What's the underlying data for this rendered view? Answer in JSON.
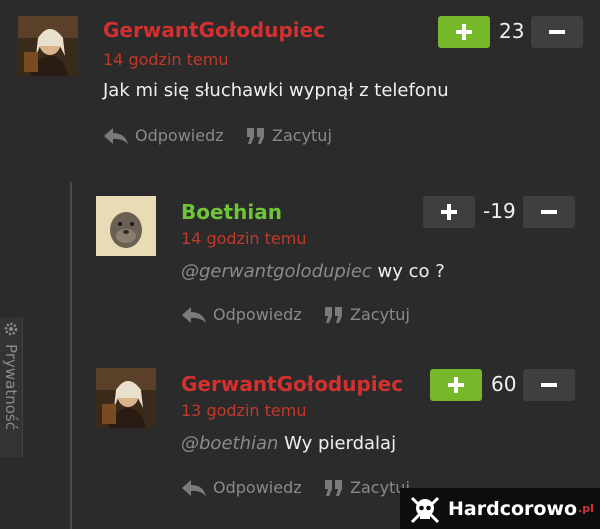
{
  "colors": {
    "background": "#2b2b2b",
    "username_red": "#d4302f",
    "username_green": "#6fc437",
    "timestamp_red": "#c0392b",
    "upvote_green": "#76b82a",
    "button_gray": "#3f3f3f",
    "muted": "#8a8a8a"
  },
  "comments": [
    {
      "username": "GerwantGołodupiec",
      "timestamp": "14 godzin temu",
      "text": "Jak mi się słuchawki wypnął z telefonu",
      "mention": "",
      "score": "23",
      "reply_label": "Odpowiedz",
      "quote_label": "Zacytuj",
      "upvote_icon": "plus-icon",
      "downvote_icon": "minus-icon"
    },
    {
      "username": "Boethian",
      "timestamp": "14 godzin temu",
      "text": "wy co ?",
      "mention": "@gerwantgolodupiec",
      "score": "-19",
      "reply_label": "Odpowiedz",
      "quote_label": "Zacytuj",
      "upvote_icon": "plus-icon",
      "downvote_icon": "minus-icon"
    },
    {
      "username": "GerwantGołodupiec",
      "timestamp": "13 godzin temu",
      "text": "Wy pierdalaj",
      "mention": "@boethian",
      "score": "60",
      "reply_label": "Odpowiedz",
      "quote_label": "Zacytuj",
      "upvote_icon": "plus-icon",
      "downvote_icon": "minus-icon"
    }
  ],
  "privacy_tab": {
    "label": "Prywatność",
    "icon": "gear-icon"
  },
  "logo": {
    "text": "Hardcorowo",
    "suffix": ".pl",
    "icon": "skull-icon"
  }
}
